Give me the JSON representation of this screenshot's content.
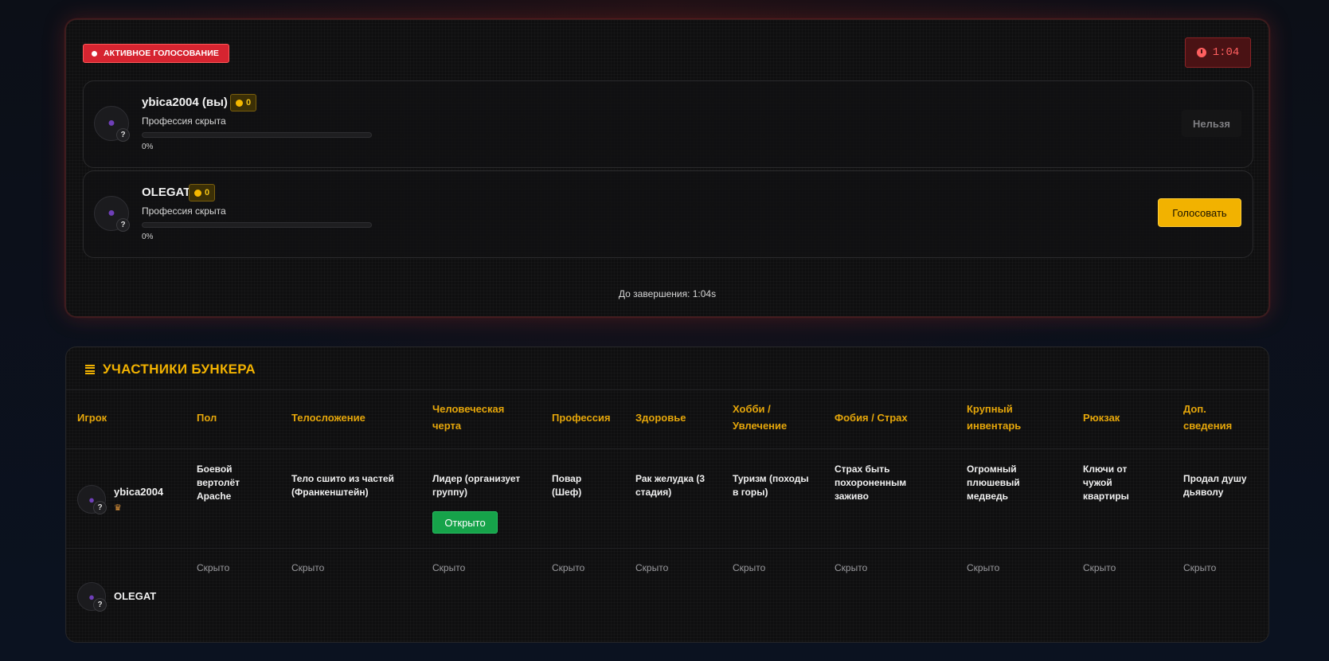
{
  "voting": {
    "badge_label": "АКТИВНОЕ ГОЛОСОВАНИЕ",
    "timer": "1:04",
    "finish_text": "До завершения: 1:04s",
    "players": [
      {
        "name": "ybica2004 (вы)",
        "coins": "0",
        "profession": "Профессия скрыта",
        "progress_label": "0%",
        "progress": 0,
        "action_label": "Нельзя",
        "can_vote": false
      },
      {
        "name": "OLEGAT",
        "coins": "0",
        "profession": "Профессия скрыта",
        "progress_label": "0%",
        "progress": 0,
        "action_label": "Голосовать",
        "can_vote": true
      }
    ]
  },
  "participants": {
    "title": "УЧАСТНИКИ БУНКЕРА",
    "columns": [
      "Игрок",
      "Пол",
      "Телосложение",
      "Человеческая черта",
      "Профессия",
      "Здоровье",
      "Хобби / Увлечение",
      "Фобия / Страх",
      "Крупный инвентарь",
      "Рюкзак",
      "Доп. сведения"
    ],
    "rows": [
      {
        "player": "ybica2004",
        "host_icon": "crown-icon",
        "cells": [
          "Боевой вертолёт Apache",
          "Тело сшито из частей (Франкенштейн)",
          "Лидер (организует группу)",
          "Повар (Шеф)",
          "Рак желудка (3 стадия)",
          "Туризм (походы в горы)",
          "Страх быть похороненным заживо",
          "Огромный плюшевый медведь",
          "Ключи от чужой квартиры",
          "Продал душу дьяволу"
        ],
        "open_button": "Открыто"
      },
      {
        "player": "OLEGAT",
        "cells": [
          "Скрыто",
          "Скрыто",
          "Скрыто",
          "Скрыто",
          "Скрыто",
          "Скрыто",
          "Скрыто",
          "Скрыто",
          "Скрыто",
          "Скрыто"
        ]
      }
    ]
  },
  "colors": {
    "accent": "#f2b200",
    "danger": "#d62430",
    "success": "#16a34a"
  }
}
